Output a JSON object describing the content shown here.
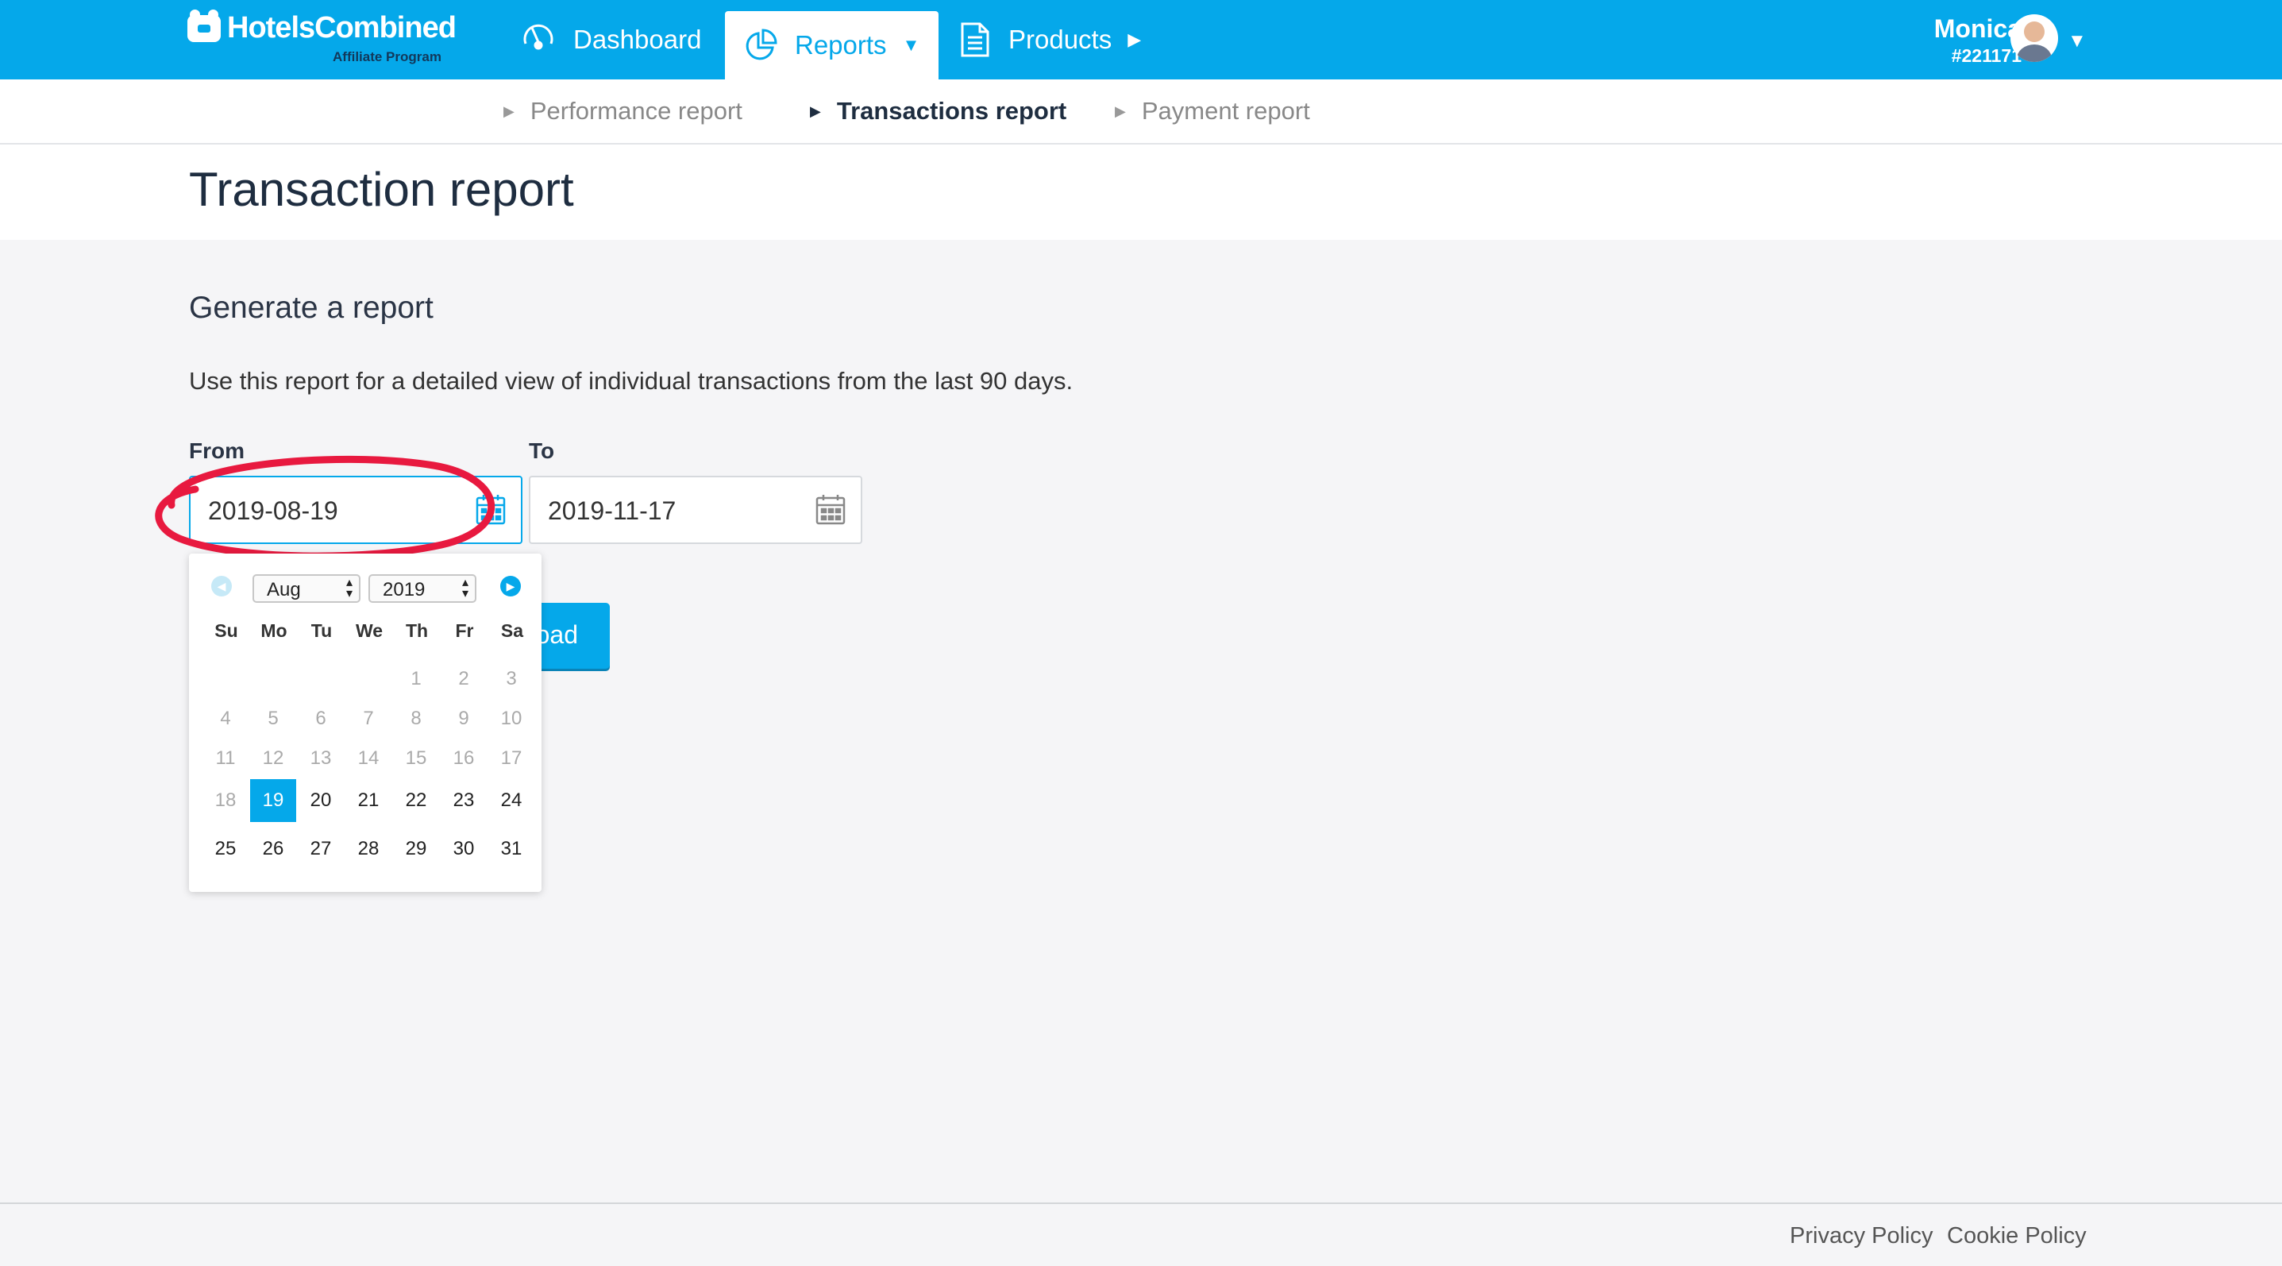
{
  "brand": {
    "name_a": "Hotels",
    "name_b": "Combined",
    "sub": "Affiliate Program"
  },
  "nav": {
    "dashboard": "Dashboard",
    "reports": "Reports",
    "products": "Products"
  },
  "user": {
    "name": "Monica",
    "id": "#221171"
  },
  "subnav": {
    "performance": "Performance report",
    "transactions": "Transactions report",
    "payment": "Payment report"
  },
  "page": {
    "title": "Transaction report"
  },
  "form": {
    "section_title": "Generate a report",
    "description": "Use this report for a detailed view of individual transactions from the last 90 days.",
    "from_label": "From",
    "to_label": "To",
    "from_value": "2019-08-19",
    "to_value": "2019-11-17",
    "download_fragment": "oad"
  },
  "datepicker": {
    "month": "Aug",
    "year": "2019",
    "weekdays": [
      "Su",
      "Mo",
      "Tu",
      "We",
      "Th",
      "Fr",
      "Sa"
    ],
    "days": [
      [
        "",
        "",
        "",
        "",
        "1",
        "2",
        "3"
      ],
      [
        "4",
        "5",
        "6",
        "7",
        "8",
        "9",
        "10"
      ],
      [
        "11",
        "12",
        "13",
        "14",
        "15",
        "16",
        "17"
      ],
      [
        "18",
        "19",
        "20",
        "21",
        "22",
        "23",
        "24"
      ],
      [
        "25",
        "26",
        "27",
        "28",
        "29",
        "30",
        "31"
      ]
    ],
    "selected_day": "19",
    "first_enabled_day": 19
  },
  "footer": {
    "privacy": "Privacy Policy",
    "cookie": "Cookie Policy"
  },
  "colors": {
    "accent": "#05a8ea",
    "annotation": "#e8193f"
  }
}
